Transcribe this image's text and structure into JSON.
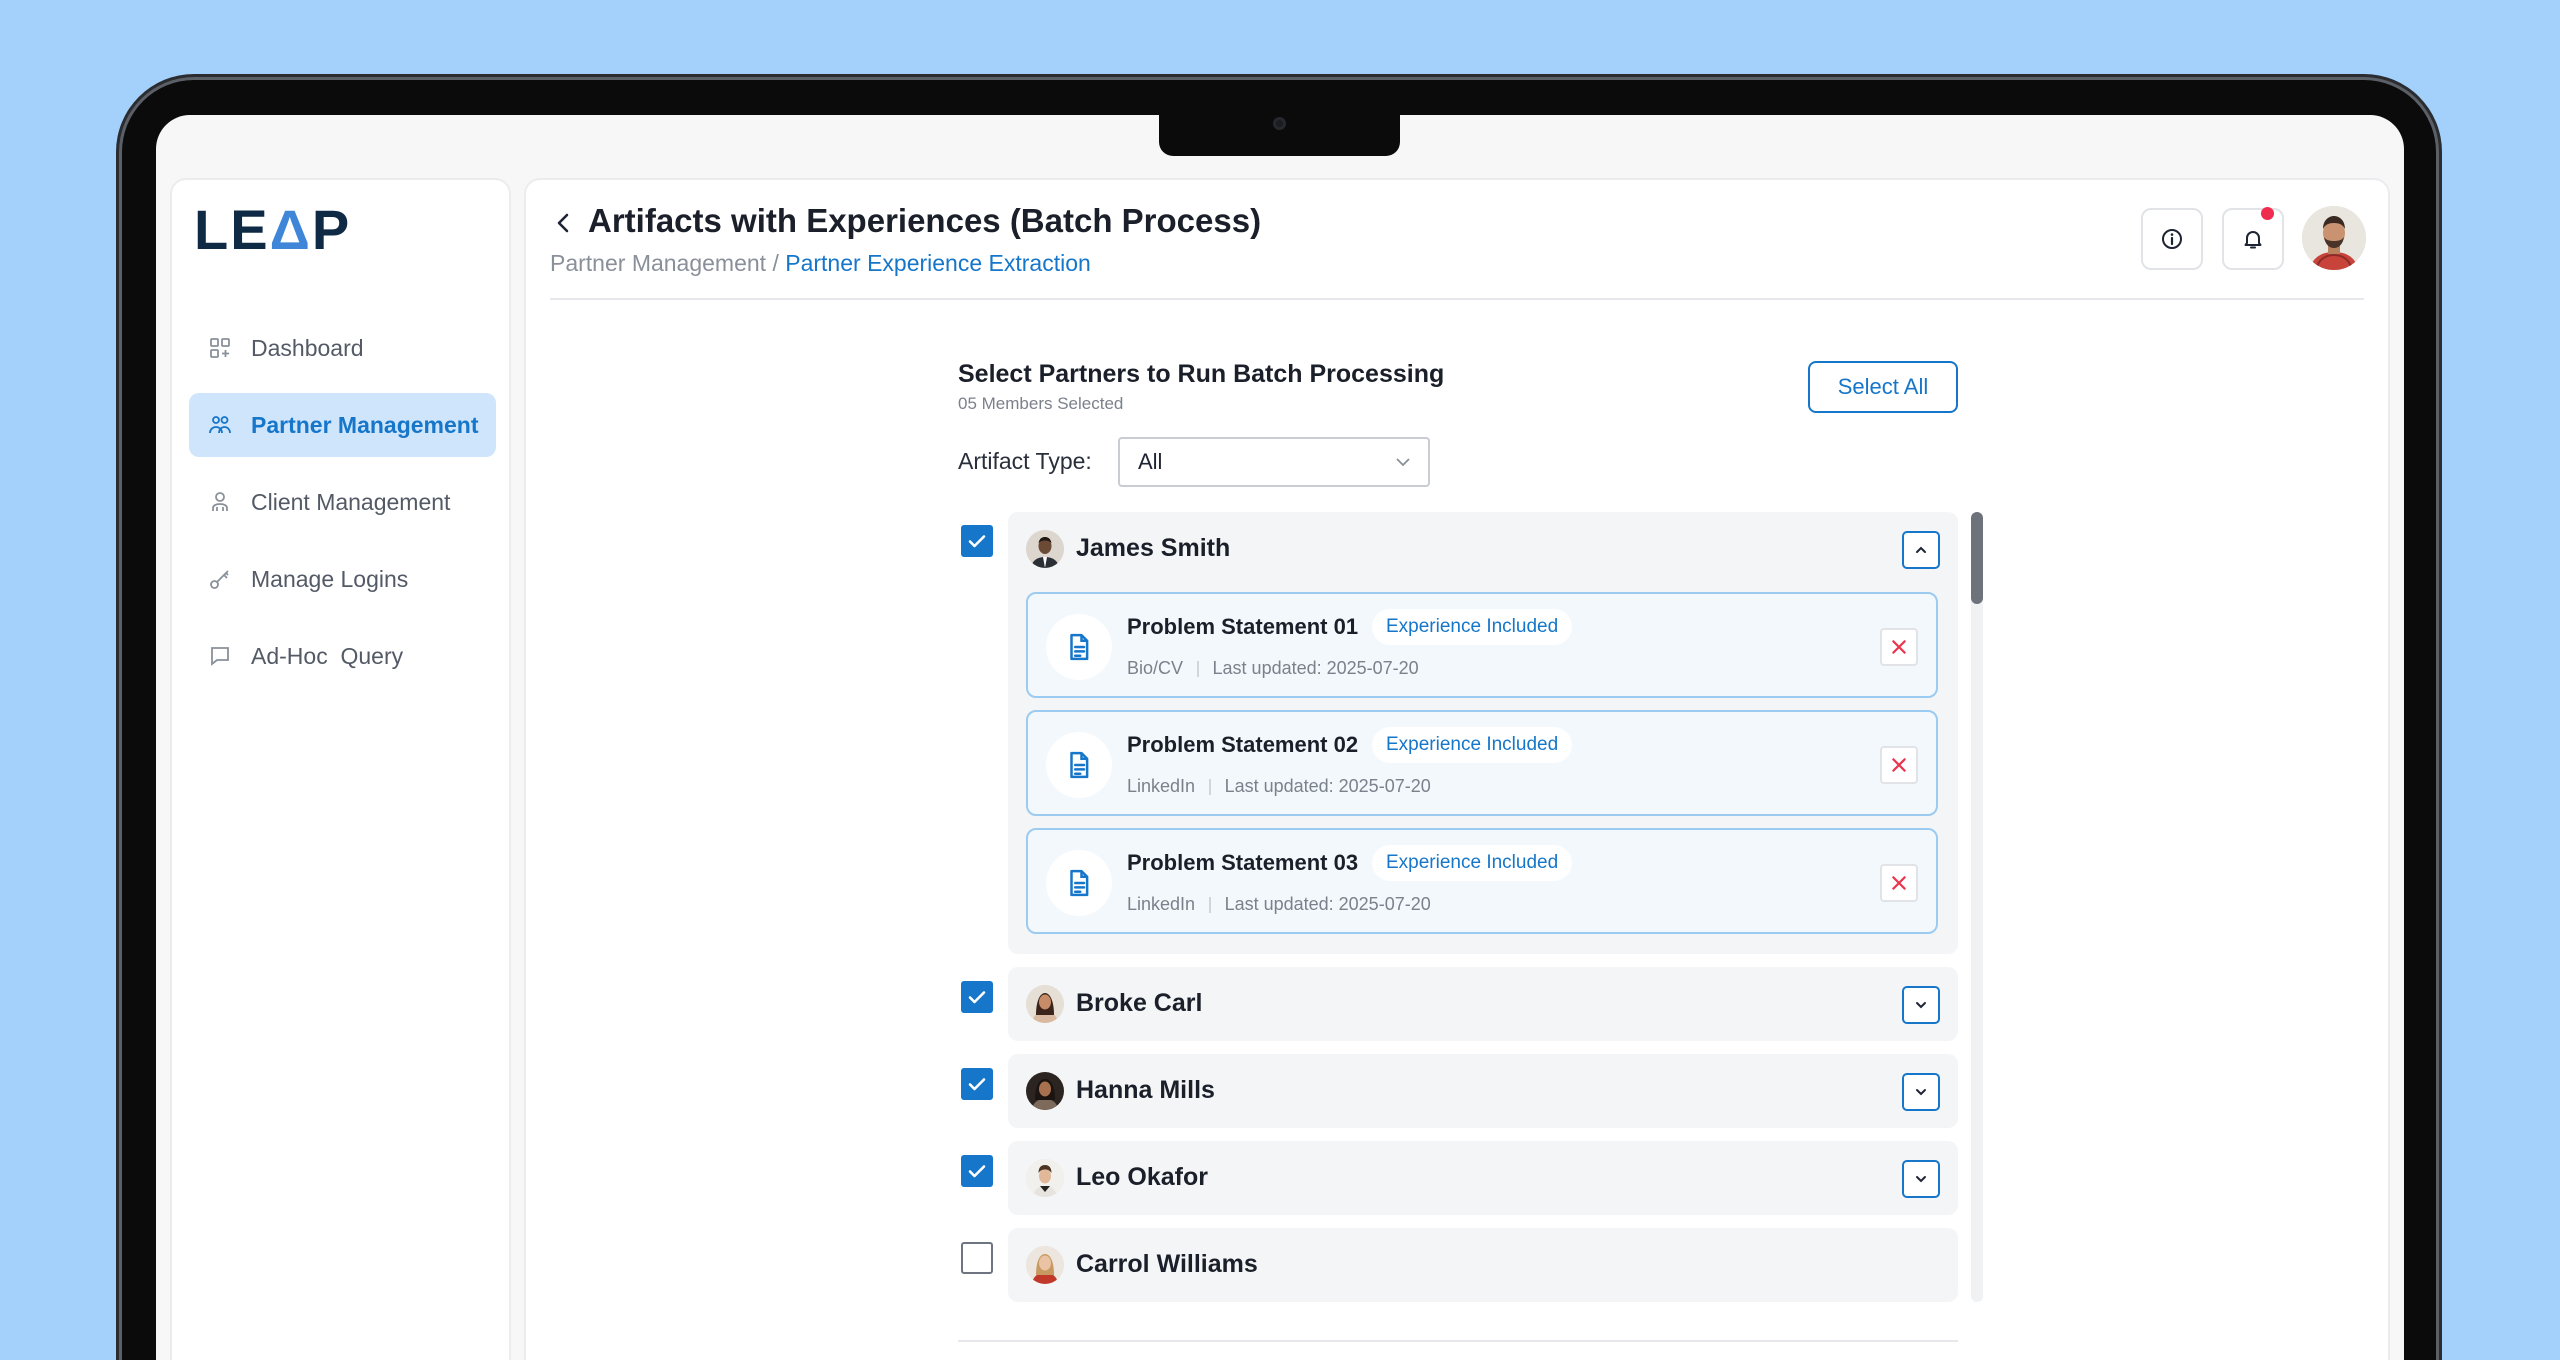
{
  "app": {
    "logo_left": "LE",
    "logo_accent": "Δ",
    "logo_right": "P"
  },
  "sidebar": {
    "items": [
      {
        "label": "Dashboard",
        "icon": "dashboard-grid-icon",
        "active": false
      },
      {
        "label": "Partner Management",
        "icon": "partners-icon",
        "active": true
      },
      {
        "label": "Client Management",
        "icon": "client-icon",
        "active": false
      },
      {
        "label": "Manage Logins",
        "icon": "key-icon",
        "active": false
      },
      {
        "label": "Ad-Hoc  Query",
        "icon": "chat-bubble-icon",
        "active": false
      }
    ]
  },
  "header": {
    "title": "Artifacts with Experiences (Batch Process)",
    "breadcrumb_parent": "Partner Management",
    "breadcrumb_separator": " / ",
    "breadcrumb_current": "Partner Experience Extraction",
    "notification_dot_color": "#ef2d4f"
  },
  "selection": {
    "title": "Select Partners to Run Batch Processing",
    "subtitle": "05 Members Selected",
    "select_all_label": "Select All",
    "artifact_type_label": "Artifact Type:",
    "artifact_type_value": "All"
  },
  "partners": [
    {
      "name": "James Smith",
      "checked": true,
      "expanded": true,
      "artifacts": [
        {
          "title": "Problem Statement 01",
          "badge": "Experience Included",
          "source": "Bio/CV",
          "updated": "Last updated: 2025-07-20"
        },
        {
          "title": "Problem Statement 02",
          "badge": "Experience Included",
          "source": "LinkedIn",
          "updated": "Last updated: 2025-07-20"
        },
        {
          "title": "Problem Statement 03",
          "badge": "Experience Included",
          "source": "LinkedIn",
          "updated": "Last updated: 2025-07-20"
        }
      ]
    },
    {
      "name": "Broke Carl",
      "checked": true,
      "expanded": false
    },
    {
      "name": "Hanna Mills",
      "checked": true,
      "expanded": false
    },
    {
      "name": "Leo Okafor",
      "checked": true,
      "expanded": false
    },
    {
      "name": "Carrol Williams",
      "checked": false,
      "expanded": false
    }
  ],
  "colors": {
    "accent": "#1676c9",
    "active_nav_bg": "#cfe5fb",
    "artifact_border": "#9ccbf1",
    "remove_icon": "#e8344e",
    "background": "#a3d1fb"
  }
}
